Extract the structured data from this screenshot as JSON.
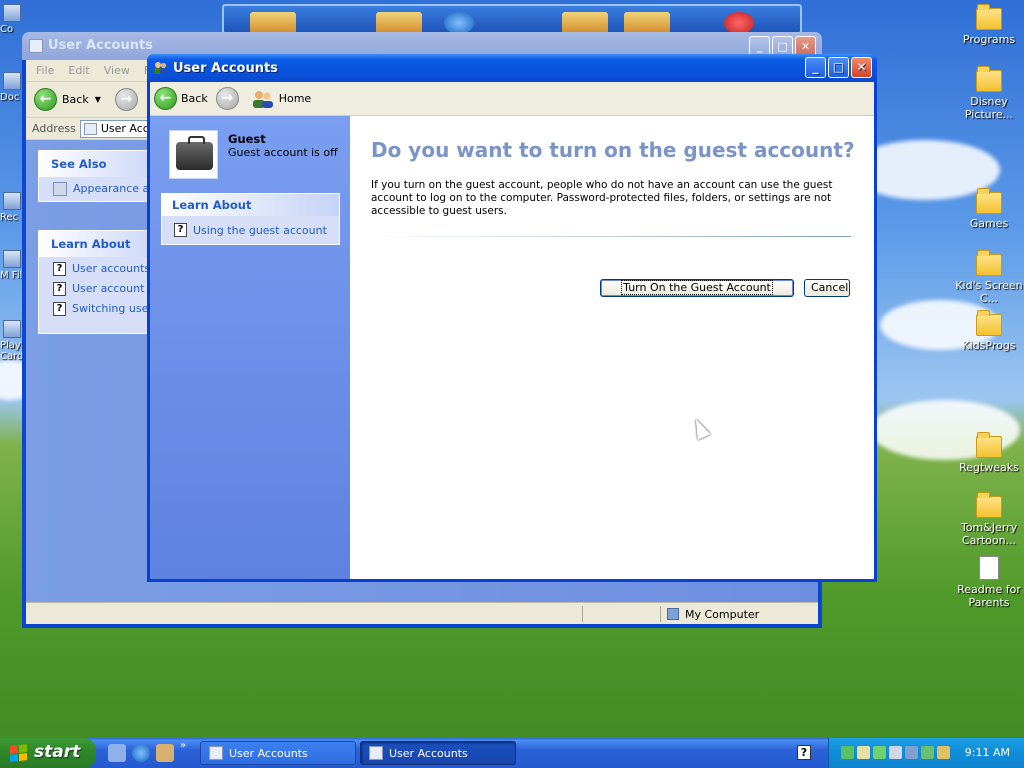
{
  "desktop": {
    "icons_right": [
      {
        "label": "Programs",
        "type": "folder"
      },
      {
        "label": "Disney Picture...",
        "type": "folder"
      },
      {
        "label": "Games",
        "type": "folder"
      },
      {
        "label": "Kid's Screen C...",
        "type": "folder"
      },
      {
        "label": "KidsProgs",
        "type": "folder"
      },
      {
        "label": "Regtweaks",
        "type": "folder"
      },
      {
        "label": "Tom&Jerry Cartoon...",
        "type": "folder"
      },
      {
        "label": "Readme for Parents",
        "type": "document"
      }
    ],
    "left_stubs": [
      "Co",
      "Doc",
      "Rec",
      "M Fil",
      "Play Card"
    ]
  },
  "back_window": {
    "title": "User Accounts",
    "menu": [
      "File",
      "Edit",
      "View",
      "F"
    ],
    "back_label": "Back",
    "address_label": "Address",
    "address_value": "User Acco",
    "see_also": {
      "heading": "See Also",
      "items": [
        "Appearance an"
      ]
    },
    "learn_about": {
      "heading": "Learn About",
      "items": [
        "User accounts",
        "User account ty",
        "Switching users"
      ]
    },
    "status": {
      "zone": "My Computer"
    }
  },
  "front_window": {
    "title": "User Accounts",
    "toolbar": {
      "back_label": "Back",
      "home_label": "Home"
    },
    "guest": {
      "name": "Guest",
      "status": "Guest account is off"
    },
    "learn_about": {
      "heading": "Learn About",
      "items": [
        "Using the guest account"
      ]
    },
    "main": {
      "question": "Do you want to turn on the guest account?",
      "description": "If you turn on the guest account, people who do not have an account can use the guest account to log on to the computer. Password-protected files, folders, or settings are not accessible to guest users.",
      "primary_button": "Turn On the Guest Account",
      "cancel_button": "Cancel"
    }
  },
  "taskbar": {
    "start_label": "start",
    "tasks": [
      {
        "label": "User Accounts",
        "active": false
      },
      {
        "label": "User Accounts",
        "active": true
      }
    ],
    "clock": "9:11 AM"
  },
  "colors": {
    "xp_blue": "#0a4fd8",
    "panel_blue": "#6f92ea",
    "link_blue": "#215dc6",
    "question_blue": "#7b94c7",
    "start_green": "#2f8a2a",
    "tray_blue": "#118fda"
  }
}
